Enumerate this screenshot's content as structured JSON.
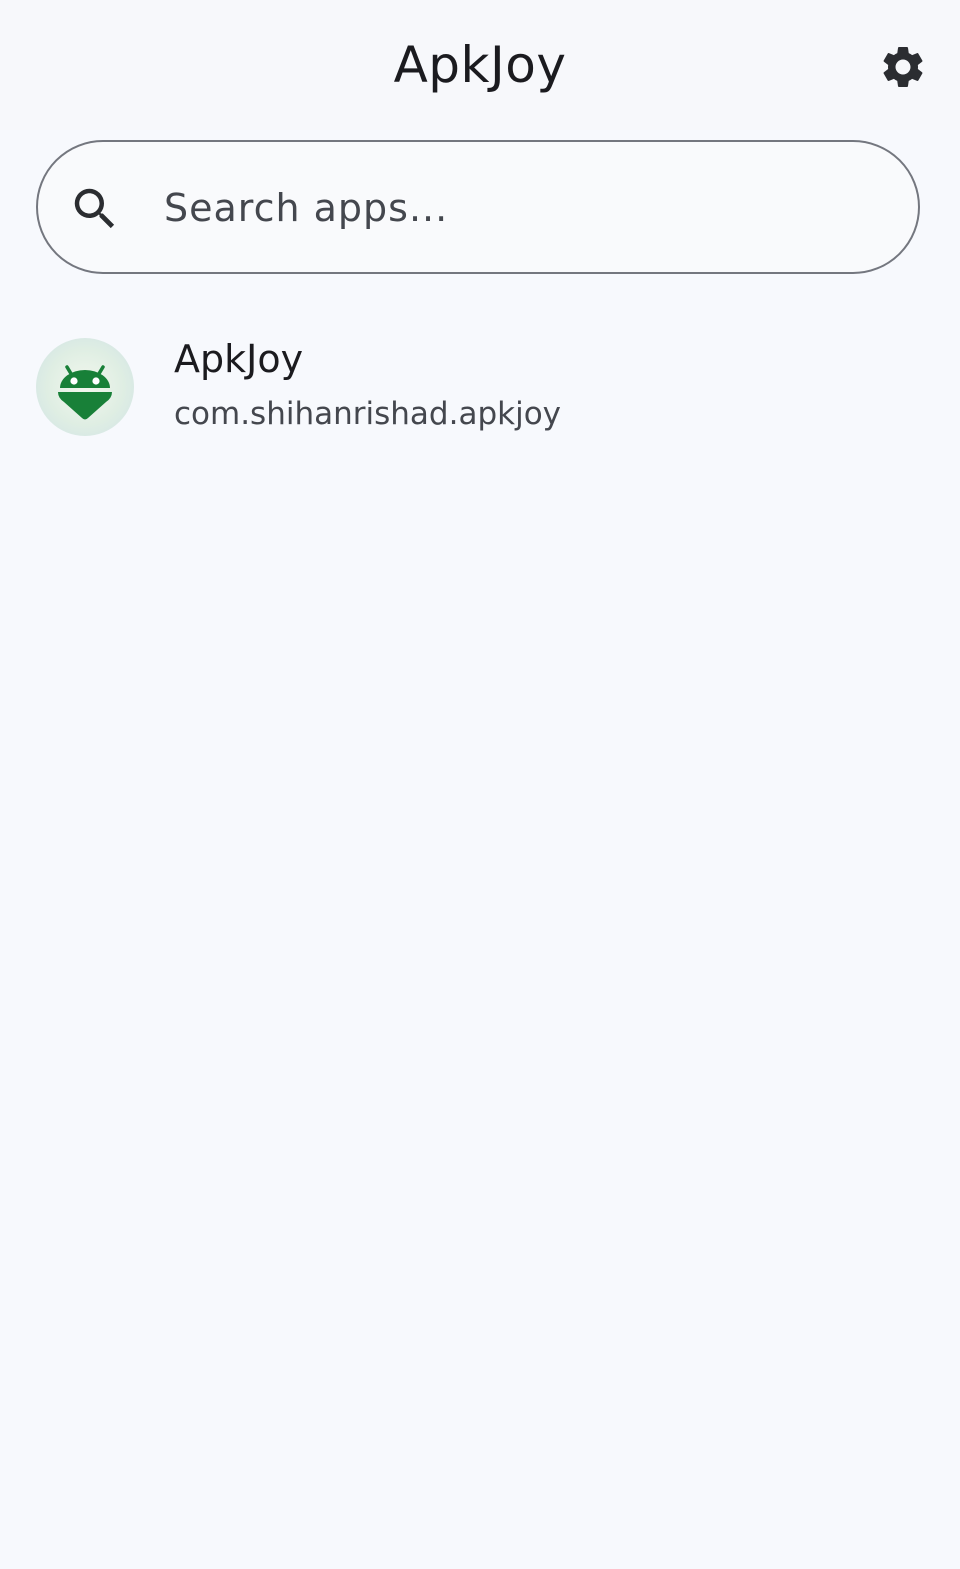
{
  "app_bar": {
    "title": "ApkJoy",
    "settings_icon": "gear-icon"
  },
  "search": {
    "placeholder": "Search apps...",
    "value": "",
    "icon": "search-icon"
  },
  "apps": [
    {
      "name": "ApkJoy",
      "package": "com.shihanrishad.apkjoy",
      "icon": "android-icon"
    }
  ],
  "colors": {
    "background": "#f7f9fd",
    "outline": "#74777f",
    "icon_green": "#188038",
    "text_primary": "#1b1b1f",
    "text_secondary": "#44474e"
  }
}
